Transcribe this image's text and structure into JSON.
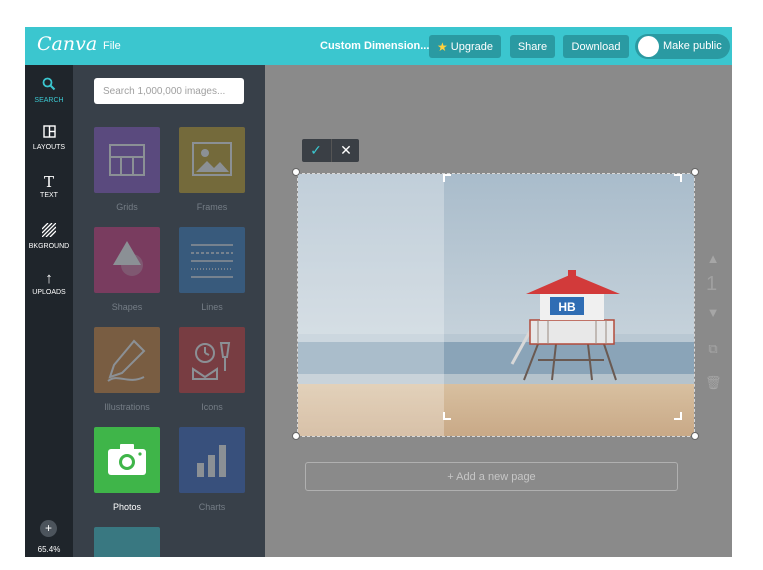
{
  "topbar": {
    "logo": "Canva",
    "file_menu": "File",
    "document_title": "Custom Dimension...",
    "upgrade_label": "Upgrade",
    "share_label": "Share",
    "download_label": "Download",
    "public_label": "Make public"
  },
  "rail": {
    "search": "SEARCH",
    "layouts": "LAYOUTS",
    "text": "TEXT",
    "background": "BKGROUND",
    "uploads": "UPLOADS",
    "zoom": "65.4%",
    "zoom_in": "+",
    "zoom_out": "−"
  },
  "panel": {
    "search_placeholder": "Search 1,000,000 images...",
    "tiles": {
      "grids": "Grids",
      "frames": "Frames",
      "shapes": "Shapes",
      "lines": "Lines",
      "illustrations": "Illustrations",
      "icons": "Icons",
      "photos": "Photos",
      "charts": "Charts"
    }
  },
  "canvas": {
    "page_number": "1",
    "add_page": "+ Add a new page",
    "image_description": "beach-lifeguard-tower-photo"
  },
  "colors": {
    "accent": "#3bc6cf",
    "rail": "#1f252b",
    "panel": "#384049",
    "canvas": "#8a8a8a"
  }
}
